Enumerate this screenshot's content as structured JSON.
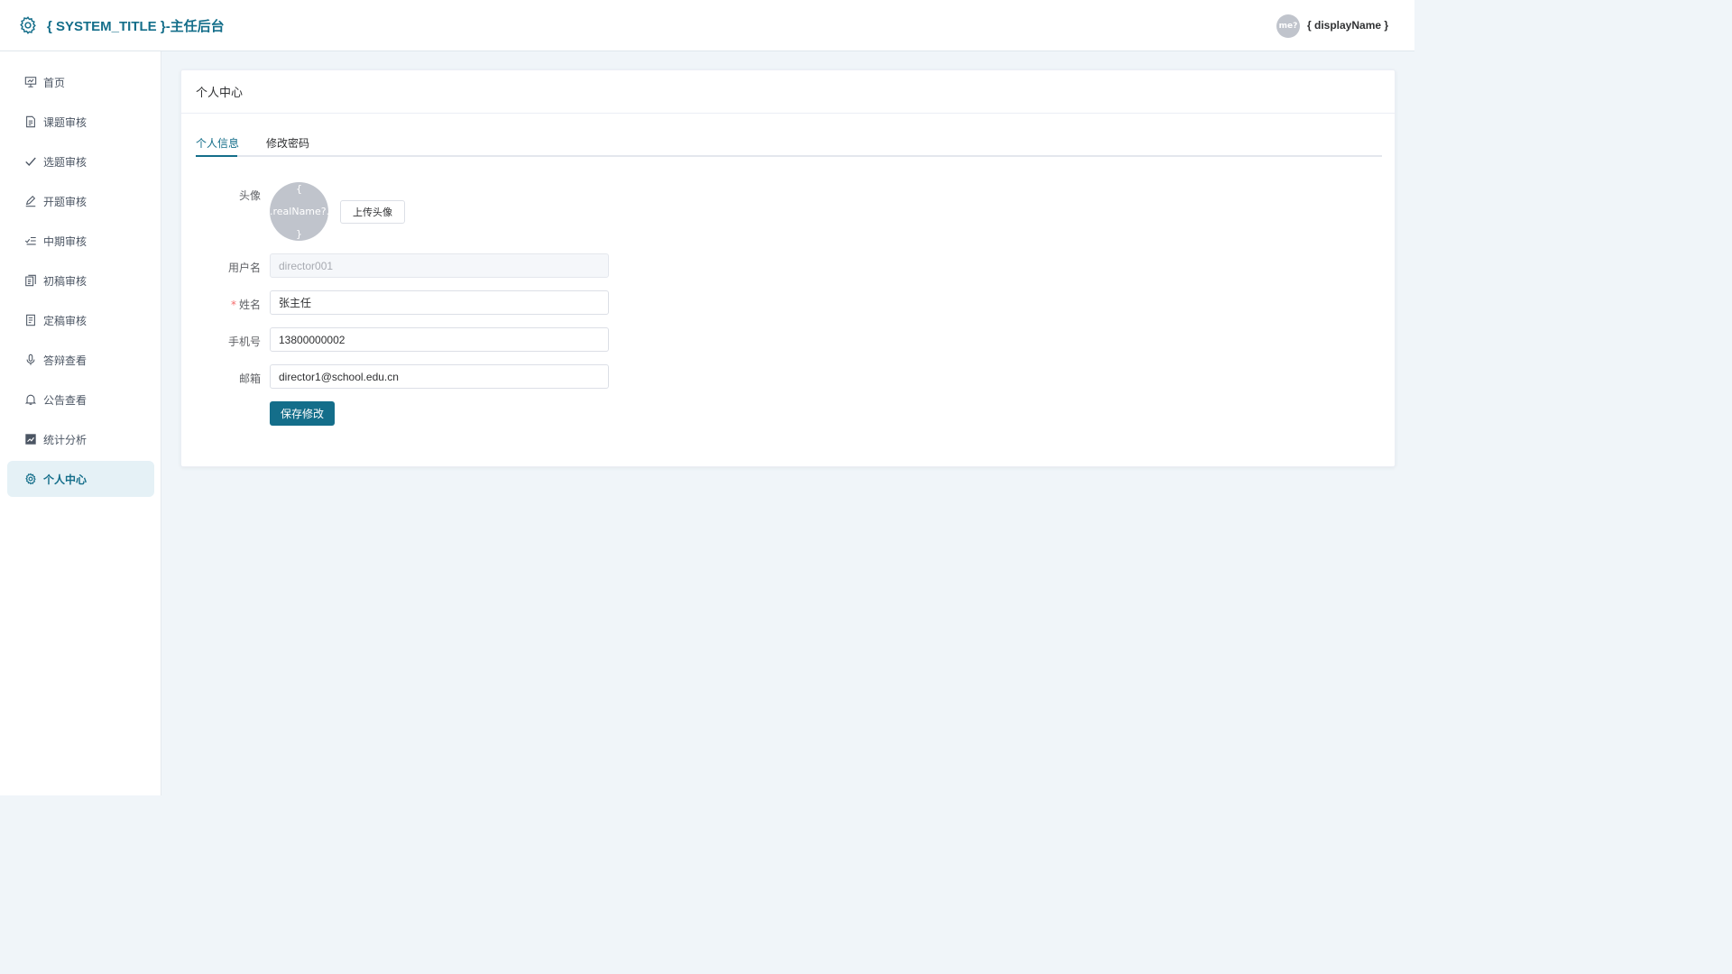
{
  "header": {
    "title": "{ SYSTEM_TITLE }-主任后台",
    "avatar_text": "me?",
    "display_name": "{ displayName }"
  },
  "sidebar": {
    "items": [
      {
        "label": "首页",
        "icon": "presentation-icon"
      },
      {
        "label": "课题审核",
        "icon": "document-icon"
      },
      {
        "label": "选题审核",
        "icon": "check-icon"
      },
      {
        "label": "开题审核",
        "icon": "pen-icon"
      },
      {
        "label": "中期审核",
        "icon": "list-check-icon"
      },
      {
        "label": "初稿审核",
        "icon": "copy-document-icon"
      },
      {
        "label": "定稿审核",
        "icon": "document-text-icon"
      },
      {
        "label": "答辩查看",
        "icon": "microphone-icon"
      },
      {
        "label": "公告查看",
        "icon": "bell-icon"
      },
      {
        "label": "统计分析",
        "icon": "chart-icon"
      },
      {
        "label": "个人中心",
        "icon": "gear-icon"
      }
    ],
    "active_index": 10
  },
  "card": {
    "title": "个人中心",
    "tabs": [
      {
        "label": "个人信息"
      },
      {
        "label": "修改密码"
      }
    ]
  },
  "form": {
    "avatar_label": "头像",
    "avatar_text_top": "{",
    "avatar_text_mid": ".realName?.",
    "avatar_text_bottom": "}",
    "upload_label": "上传头像",
    "username_label": "用户名",
    "username_value": "director001",
    "realname_label": "姓名",
    "realname_value": "张主任",
    "phone_label": "手机号",
    "phone_value": "13800000002",
    "email_label": "邮箱",
    "email_value": "director1@school.edu.cn",
    "save_label": "保存修改"
  },
  "colors": {
    "accent": "#146e8a",
    "active_bg": "#e5f1f6",
    "page_bg": "#f0f5f9",
    "required": "#f56c6c"
  }
}
